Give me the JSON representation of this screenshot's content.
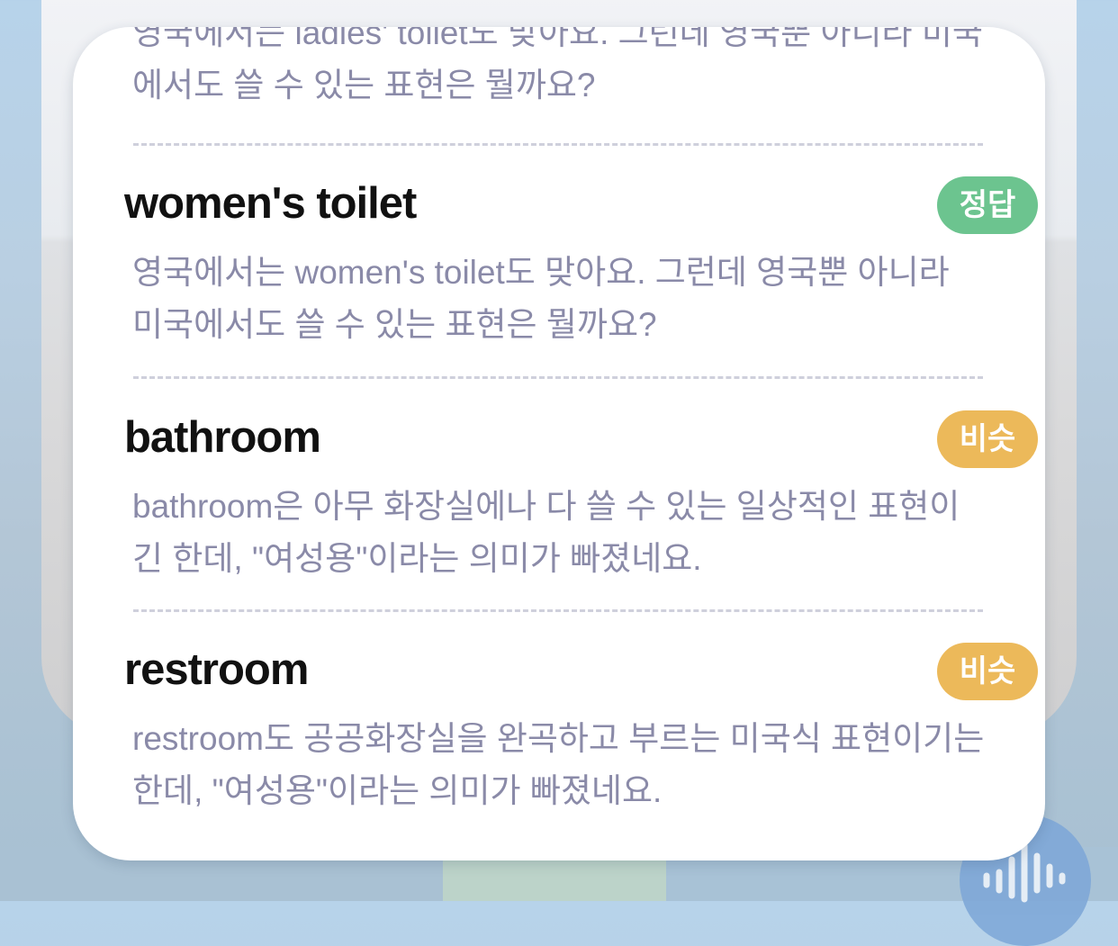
{
  "prev_desc": "영국에서는 ladies' toilet도 맞아요. 그런데 영국뿐 아니라 미국에서도 쓸 수 있는 표현은 뭘까요?",
  "colors": {
    "correct_badge": "#6cc48f",
    "similar_badge": "#ecb95a",
    "word": "#111111",
    "description": "#8a8aa8",
    "divider": "#cfd0dc"
  },
  "options": [
    {
      "word": "women's toilet",
      "badge": "정답",
      "badge_type": "correct",
      "desc": "영국에서는 women's toilet도 맞아요. 그런데 영국뿐 아니라 미국에서도 쓸 수 있는 표현은 뭘까요?"
    },
    {
      "word": "bathroom",
      "badge": "비슷",
      "badge_type": "similar",
      "desc": "bathroom은 아무 화장실에나 다 쓸 수 있는 일상적인 표현이긴 한데, \"여성용\"이라는 의미가 빠졌네요."
    },
    {
      "word": "restroom",
      "badge": "비슷",
      "badge_type": "similar",
      "desc": "restroom도 공공화장실을 완곡하고 부르는 미국식 표현이기는 한데, \"여성용\"이라는 의미가 빠졌네요."
    }
  ],
  "voice_button_icon": "sound-wave-icon"
}
